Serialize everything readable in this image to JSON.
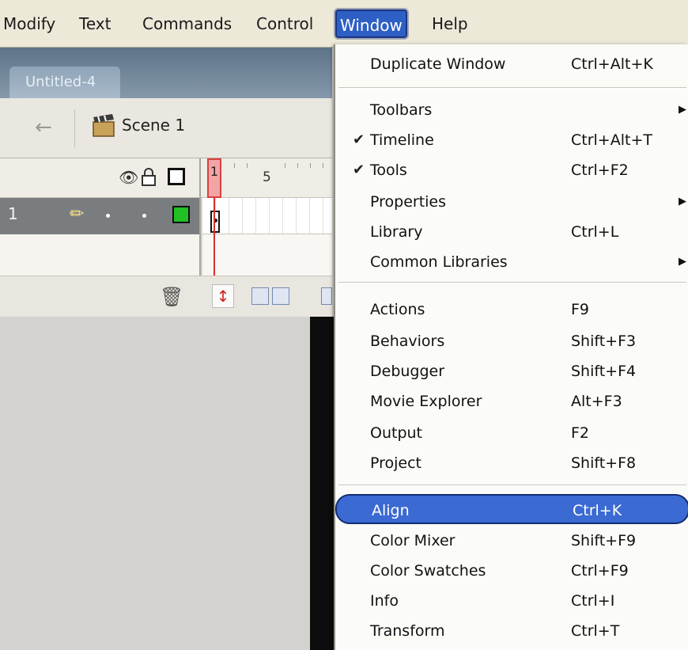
{
  "menubar": {
    "items": [
      "Modify",
      "Text",
      "Commands",
      "Control",
      "Window",
      "Help"
    ],
    "active": "Window"
  },
  "document": {
    "tab_title": "Untitled-4",
    "scene_label": "Scene 1"
  },
  "timeline": {
    "frame_labels": [
      "1",
      "5"
    ],
    "layer_number": "1"
  },
  "window_menu": {
    "groups": [
      [
        {
          "label": "Duplicate Window",
          "shortcut": "Ctrl+Alt+K"
        }
      ],
      [
        {
          "label": "Toolbars",
          "submenu": true
        },
        {
          "label": "Timeline",
          "shortcut": "Ctrl+Alt+T",
          "checked": true
        },
        {
          "label": "Tools",
          "shortcut": "Ctrl+F2",
          "checked": true
        },
        {
          "label": "Properties",
          "submenu": true
        },
        {
          "label": "Library",
          "shortcut": "Ctrl+L"
        },
        {
          "label": "Common Libraries",
          "submenu": true
        }
      ],
      [
        {
          "label": "Actions",
          "shortcut": "F9"
        },
        {
          "label": "Behaviors",
          "shortcut": "Shift+F3"
        },
        {
          "label": "Debugger",
          "shortcut": "Shift+F4"
        },
        {
          "label": "Movie Explorer",
          "shortcut": "Alt+F3"
        },
        {
          "label": "Output",
          "shortcut": "F2"
        },
        {
          "label": "Project",
          "shortcut": "Shift+F8"
        }
      ],
      [
        {
          "label": "Align",
          "shortcut": "Ctrl+K",
          "highlighted": true
        },
        {
          "label": "Color Mixer",
          "shortcut": "Shift+F9"
        },
        {
          "label": "Color Swatches",
          "shortcut": "Ctrl+F9"
        },
        {
          "label": "Info",
          "shortcut": "Ctrl+I"
        },
        {
          "label": "Transform",
          "shortcut": "Ctrl+T"
        }
      ]
    ]
  }
}
